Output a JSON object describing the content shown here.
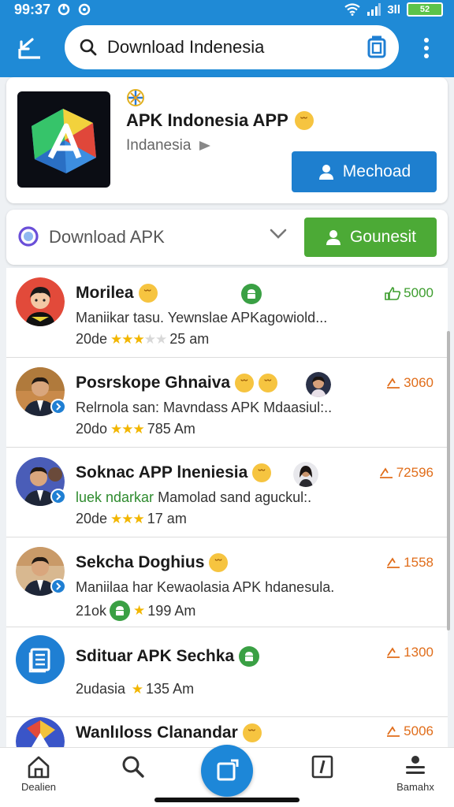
{
  "status_bar": {
    "time": "99:37",
    "signal_text": "3ll",
    "battery": "52"
  },
  "app_bar": {
    "search_value": "Download Indenesia"
  },
  "hero": {
    "title": "APK Indonesia APP",
    "subtitle": "Indanesia",
    "button_label": "Mechoad"
  },
  "filter": {
    "value": "Download APK",
    "button_label": "Gounesit"
  },
  "list": {
    "items": [
      {
        "title": "Morilea",
        "desc": "Maniikar tasu. Yewnslae APKagowiold...",
        "meta_prefix": "20de",
        "rating": 3,
        "time": "25 am",
        "count": "5000",
        "count_color": "green"
      },
      {
        "title": "Posrskope Ghnaiva",
        "desc": "Relrnola san: Mavndass APK Mdaasiul:..",
        "meta_prefix": "20do",
        "rating": 3,
        "time": "785 Am",
        "count": "3060",
        "count_color": "orange"
      },
      {
        "title": "Soknac APP lneniesia",
        "desc_green": "luek ndarkar",
        "desc": "Mamolad sand aguckul:.",
        "meta_prefix": "20de",
        "rating": 3,
        "time": "17 am",
        "count": "72596",
        "count_color": "orange"
      },
      {
        "title": "Sekcha Doghius",
        "desc": "Maniilaa har Kewaolasia APK hdanesula.",
        "meta_prefix": "21ok",
        "rating": 1,
        "time": "199 Am",
        "count": "1558",
        "count_color": "orange"
      },
      {
        "title": "Sdituar APK Sechka",
        "desc": "",
        "meta_prefix": "2udasia",
        "rating": 1,
        "time": "135 Am",
        "count": "1300",
        "count_color": "orange"
      },
      {
        "title": "Wanlıloss Clanandar",
        "desc": "",
        "meta_prefix": "",
        "rating": 0,
        "time": "",
        "count": "5006",
        "count_color": "orange"
      }
    ]
  },
  "bottom_nav": {
    "home_label": "Dealien",
    "profile_label": "Bamahx"
  },
  "colors": {
    "primary": "#1f8ad6",
    "accent_green": "#4caa36",
    "count_orange": "#e06d1a",
    "star": "#f2b600"
  }
}
